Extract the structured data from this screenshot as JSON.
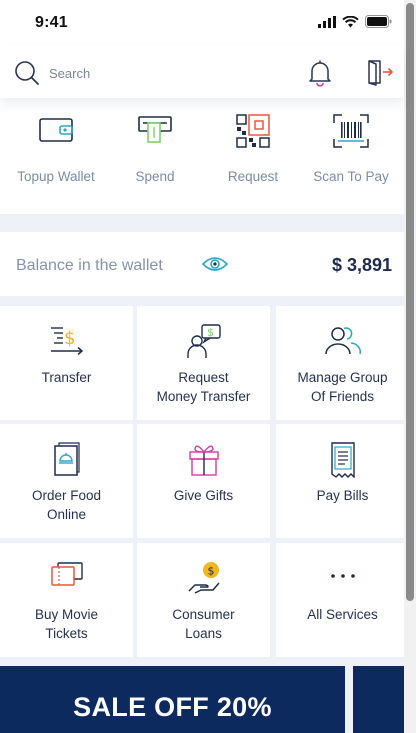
{
  "status_bar": {
    "time": "9:41"
  },
  "header": {
    "search_label": "Search"
  },
  "quick_actions": [
    {
      "label": "Topup Wallet",
      "icon": "wallet-icon"
    },
    {
      "label": "Spend",
      "icon": "atm-icon"
    },
    {
      "label": "Request",
      "icon": "qr-code-icon"
    },
    {
      "label": "Scan To Pay",
      "icon": "barcode-scan-icon"
    }
  ],
  "balance": {
    "label": "Balance in the wallet",
    "amount": "$ 3,891"
  },
  "services": [
    {
      "label": "Transfer",
      "icon": "transfer-icon"
    },
    {
      "label": "Request\nMoney Transfer",
      "icon": "request-money-icon"
    },
    {
      "label": "Manage Group\nOf Friends",
      "icon": "friends-group-icon"
    },
    {
      "label": "Order Food\nOnline",
      "icon": "food-menu-icon"
    },
    {
      "label": "Give Gifts",
      "icon": "gift-icon"
    },
    {
      "label": "Pay Bills",
      "icon": "bill-icon"
    },
    {
      "label": "Buy Movie\nTickets",
      "icon": "ticket-icon"
    },
    {
      "label": "Consumer\nLoans",
      "icon": "loan-hand-icon"
    },
    {
      "label": "All Services",
      "icon": "more-dots-icon"
    }
  ],
  "promo": {
    "text": "SALE OFF 20%"
  },
  "colors": {
    "navy": "#0c2a5e",
    "accent": "#e8573f",
    "teal": "#2aa7c9",
    "pink": "#d63aa0",
    "yellow": "#f3b51c"
  }
}
